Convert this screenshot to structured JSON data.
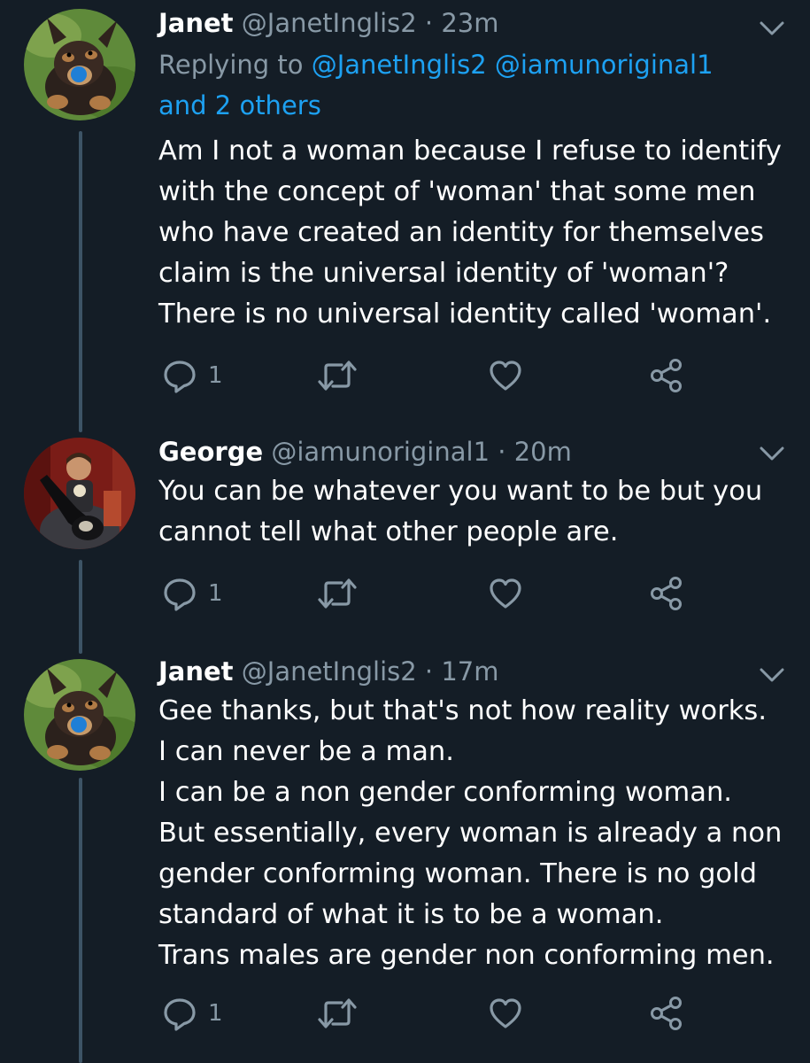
{
  "colors": {
    "background": "#141d26",
    "secondary_text": "#8899a6",
    "mention": "#1da1f2",
    "thread_line": "#3d5466"
  },
  "tweets": [
    {
      "name": "Janet",
      "handle": "@JanetInglis2",
      "separator": "·",
      "time": "23m",
      "replying_prefix": "Replying to",
      "replying_mentions": "@JanetInglis2 @iamunoriginal1",
      "replying_others": "and 2 others",
      "text": "Am I not a woman because I refuse to identify\nwith the concept of 'woman' that some men\nwho have created an identity for themselves\nclaim is the universal identity of 'woman'?\nThere is no universal identity called 'woman'.",
      "reply_count": "1",
      "avatar_icon": "dog-avatar",
      "menu_icon": "chevron-down-icon"
    },
    {
      "name": "George",
      "handle": "@iamunoriginal1",
      "separator": "·",
      "time": "20m",
      "text": "You can be whatever you want to be but you\ncannot tell what other people are.",
      "reply_count": "1",
      "avatar_icon": "guitarist-avatar",
      "menu_icon": "chevron-down-icon"
    },
    {
      "name": "Janet",
      "handle": "@JanetInglis2",
      "separator": "·",
      "time": "17m",
      "text": "Gee thanks, but that's not how reality works.\nI can never be a man.\nI can be a non gender conforming woman.\nBut essentially, every woman is already a non\ngender conforming woman. There is no gold\nstandard of what it is to be a woman.\nTrans males are gender non conforming men.",
      "reply_count": "1",
      "avatar_icon": "dog-avatar",
      "menu_icon": "chevron-down-icon"
    }
  ],
  "action_icons": [
    "reply-icon",
    "retweet-icon",
    "like-icon",
    "share-icon"
  ]
}
